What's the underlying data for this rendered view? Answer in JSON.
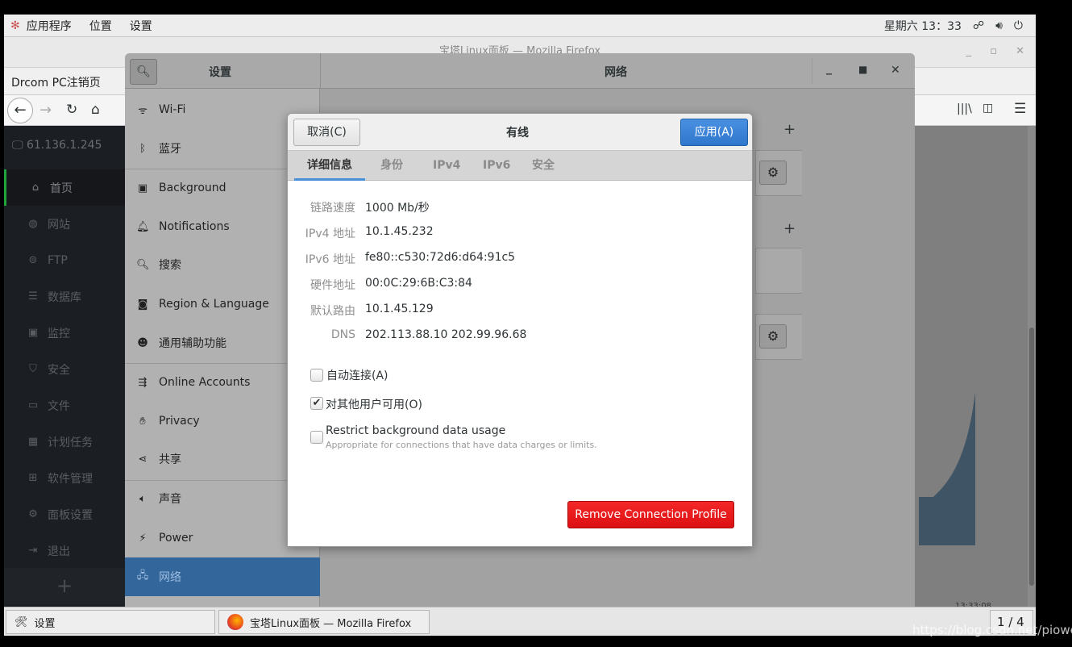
{
  "topbar": {
    "menus": [
      "应用程序",
      "位置",
      "设置"
    ],
    "clock": "星期六 13：33",
    "icons": [
      "network-icon",
      "volume-icon",
      "power-icon"
    ]
  },
  "firefox": {
    "title": "宝塔Linux面板 — Mozilla Firefox",
    "tab": "Drcom PC注销页"
  },
  "bt": {
    "server": "61.136.1.245",
    "items": [
      {
        "label": "首页",
        "icon": "⌂"
      },
      {
        "label": "网站",
        "icon": "◍"
      },
      {
        "label": "FTP",
        "icon": "⊜"
      },
      {
        "label": "数据库",
        "icon": "☰"
      },
      {
        "label": "监控",
        "icon": "▣"
      },
      {
        "label": "安全",
        "icon": "⛉"
      },
      {
        "label": "文件",
        "icon": "▭"
      },
      {
        "label": "计划任务",
        "icon": "▦"
      },
      {
        "label": "软件管理",
        "icon": "⊞"
      },
      {
        "label": "面板设置",
        "icon": "⚙"
      },
      {
        "label": "退出",
        "icon": "⇥"
      }
    ],
    "add": "+",
    "chart_time": "13:33:08"
  },
  "settings": {
    "title": "设置",
    "panel_title": "网络",
    "items": [
      {
        "label": "Wi-Fi",
        "icon": "wifi"
      },
      {
        "label": "蓝牙",
        "icon": "bluetooth"
      },
      {
        "label": "Background",
        "icon": "background"
      },
      {
        "label": "Notifications",
        "icon": "bell"
      },
      {
        "label": "搜索",
        "icon": "search"
      },
      {
        "label": "Region & Language",
        "icon": "region"
      },
      {
        "label": "通用辅助功能",
        "icon": "accessibility"
      },
      {
        "label": "Online Accounts",
        "icon": "online-accounts"
      },
      {
        "label": "Privacy",
        "icon": "hand"
      },
      {
        "label": "共享",
        "icon": "share"
      },
      {
        "label": "声音",
        "icon": "speaker"
      },
      {
        "label": "Power",
        "icon": "power"
      },
      {
        "label": "网络",
        "icon": "network"
      }
    ],
    "selected": "网络"
  },
  "dialog": {
    "cancel": "取消(C)",
    "title": "有线",
    "apply": "应用(A)",
    "tabs": [
      "详细信息",
      "身份",
      "IPv4",
      "IPv6",
      "安全"
    ],
    "active_tab": "详细信息",
    "details": [
      {
        "k": "链路速度",
        "v": "1000 Mb/秒"
      },
      {
        "k": "IPv4 地址",
        "v": "10.1.45.232"
      },
      {
        "k": "IPv6 地址",
        "v": "fe80::c530:72d6:d64:91c5"
      },
      {
        "k": "硬件地址",
        "v": "00:0C:29:6B:C3:84"
      },
      {
        "k": "默认路由",
        "v": "10.1.45.129"
      },
      {
        "k": "DNS",
        "v": "202.113.88.10 202.99.96.68"
      }
    ],
    "auto_connect": {
      "label": "自动连接(A)",
      "checked": false
    },
    "all_users": {
      "label": "对其他用户可用(O)",
      "checked": true
    },
    "restrict": {
      "label": "Restrict background data usage",
      "hint": "Appropriate for connections that have data charges or limits.",
      "checked": false
    },
    "remove": "Remove Connection Profile"
  },
  "taskbar": {
    "items": [
      "设置",
      "宝塔Linux面板 — Mozilla Firefox"
    ],
    "pager": "1 / 4"
  },
  "watermark": "https://blog.csdn.net/piowe",
  "colors": {
    "accent": "#3d85d8",
    "danger": "#e8161a",
    "selected": "#33669a"
  }
}
